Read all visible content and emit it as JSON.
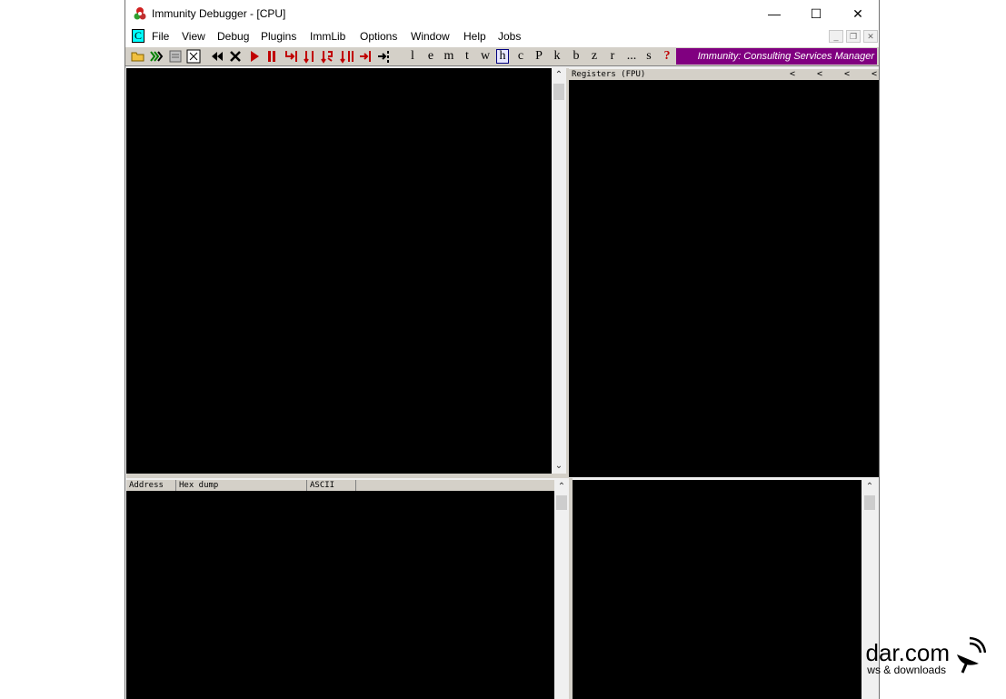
{
  "window": {
    "title": "Immunity Debugger - [CPU]",
    "controls": {
      "minimize": "—",
      "maximize": "☐",
      "close": "✕"
    }
  },
  "menubar": {
    "cpu_icon": "C",
    "items": [
      "File",
      "View",
      "Debug",
      "Plugins",
      "ImmLib",
      "Options",
      "Window",
      "Help",
      "Jobs"
    ],
    "mdi": {
      "minimize": "_",
      "restore": "❐",
      "close": "✕"
    }
  },
  "toolbar": {
    "icons": [
      "open-icon",
      "restart-icon",
      "close-file-icon",
      "list-icon",
      "rewind-icon",
      "stop-icon",
      "run-icon",
      "pause-icon",
      "step-into-icon",
      "step-over-icon",
      "trace-into-icon",
      "trace-over-icon",
      "execute-till-return-icon",
      "goto-icon"
    ],
    "letters": [
      "l",
      "e",
      "m",
      "t",
      "w",
      "h",
      "c",
      "P",
      "k",
      "b",
      "z",
      "r",
      "...",
      "s",
      "?"
    ],
    "active_letter": "h",
    "consulting_label": "Immunity: Consulting Services Manager"
  },
  "panes": {
    "registers_header": "Registers (FPU)",
    "registers_arrows": [
      "<",
      "<",
      "<",
      "<"
    ],
    "dump_columns": [
      "Address",
      "Hex dump",
      "ASCII"
    ]
  },
  "watermark": {
    "text": "dar.com",
    "sub": "ws & downloads"
  },
  "colors": {
    "pane_bg": "#000000",
    "consulting_bg": "#800080",
    "toolbar_red": "#c00000"
  }
}
